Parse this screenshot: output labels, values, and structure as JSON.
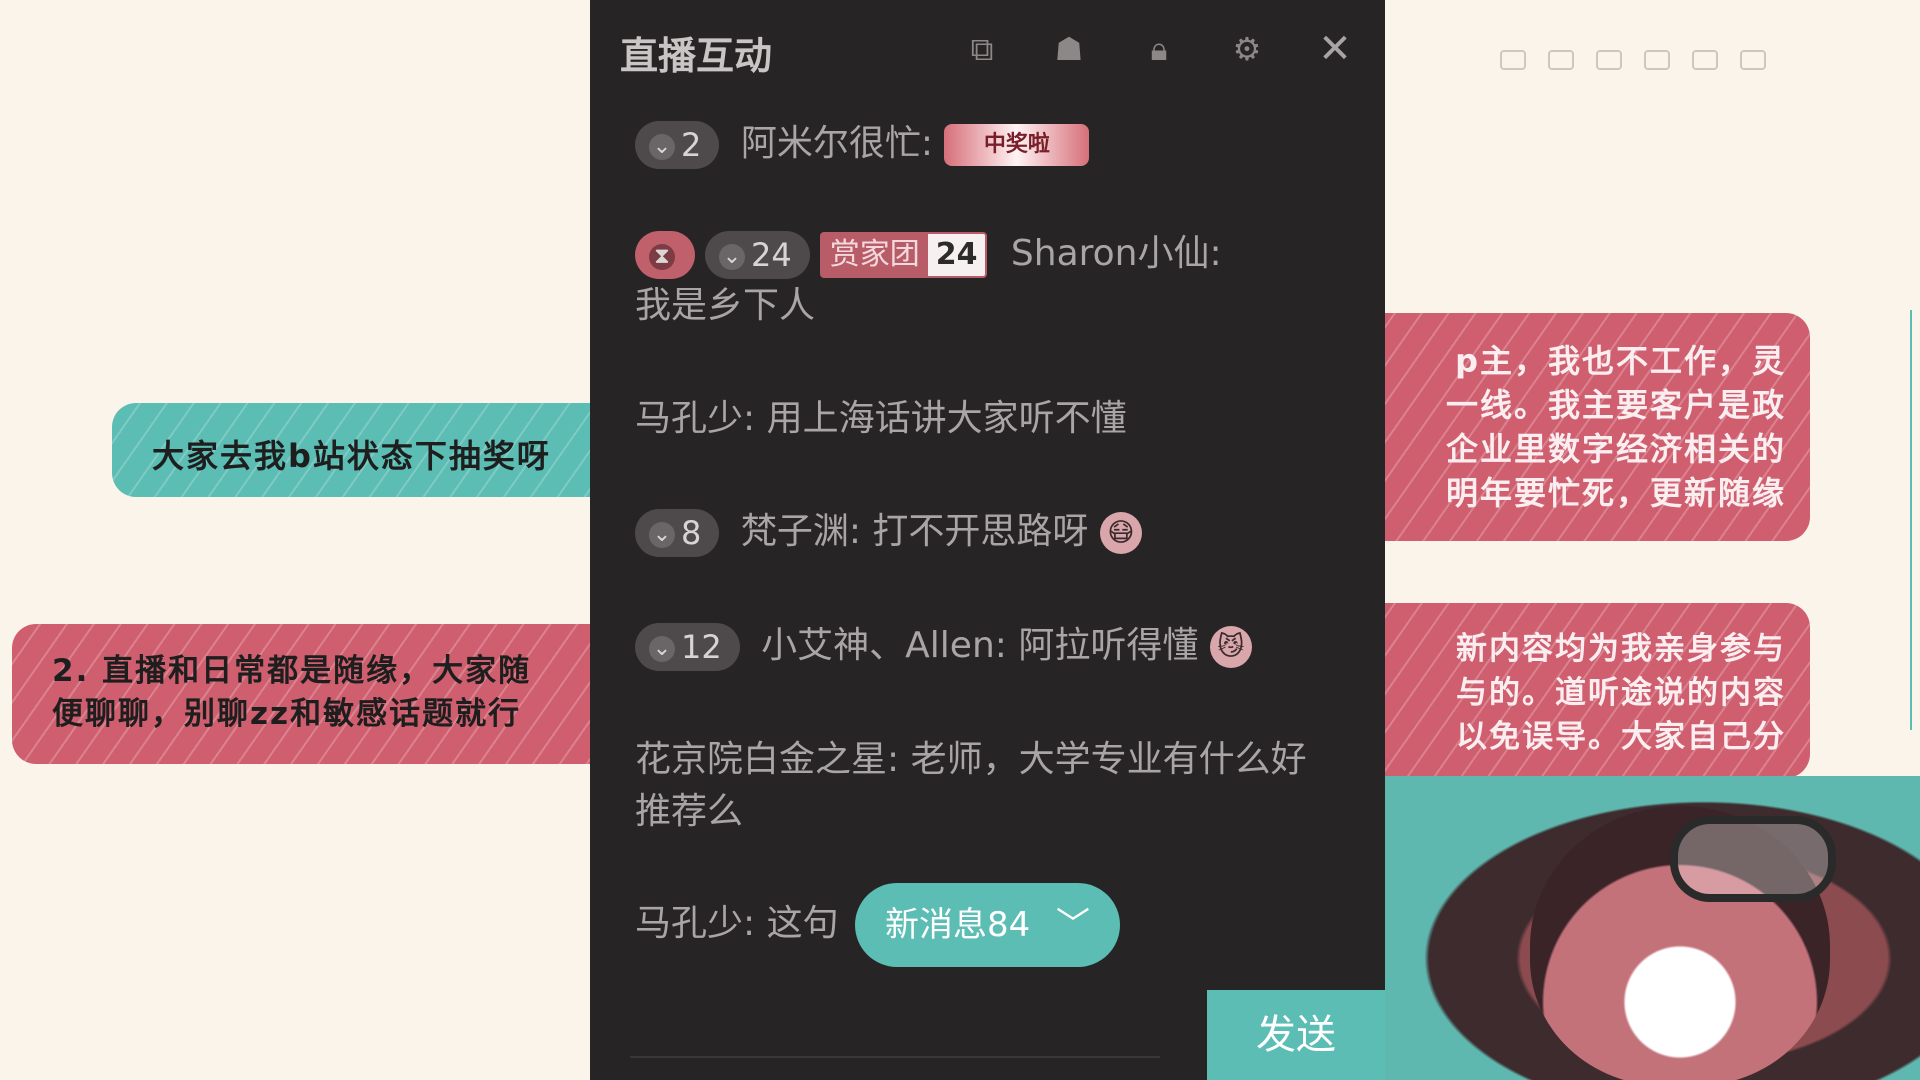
{
  "chat": {
    "title": "直播互动",
    "header_icons": [
      "popout-icon",
      "skin-icon",
      "lock-icon",
      "settings-icon",
      "close-icon"
    ],
    "close_glyph": "✕",
    "messages": [
      {
        "level": "2",
        "name": "阿米尔很忙:",
        "sticker": "中奖啦"
      },
      {
        "medal_icon": "hourglass-medal",
        "level": "24",
        "fan_club": "赏家团",
        "fan_level": "24",
        "name": "Sharon小仙:",
        "text": "我是乡下人"
      },
      {
        "name": "马孔少:",
        "text": "用上海话讲大家听不懂"
      },
      {
        "level": "8",
        "name": "梵子渊:",
        "text": "打不开思路呀"
      },
      {
        "level": "12",
        "name": "小艾神、Allen:",
        "text": "阿拉听得懂"
      },
      {
        "name": "花京院白金之星:",
        "text": "老师，大学专业有什么好推荐么"
      },
      {
        "name": "马孔少:",
        "text": "这句"
      }
    ],
    "new_messages_label": "新消息84",
    "send_label": "发送"
  },
  "notes": {
    "left_1": "大家去我b站状态下抽奖呀",
    "left_2_line_1": "2. 直播和日常都是随缘，大家随",
    "left_2_line_2": "便聊聊，别聊zz和敏感话题就行",
    "right_1_line_1": "p主，我也不工作，灵",
    "right_1_line_2": "一线。我主要客户是政",
    "right_1_line_3": "企业里数字经济相关的",
    "right_1_line_4": "明年要忙死，更新随缘",
    "right_2_line_1": "新内容均为我亲身参与",
    "right_2_line_2": "与的。道听途说的内容",
    "right_2_line_3": "以免误导。大家自己分"
  },
  "colors": {
    "teal": "#5bbdb3",
    "rose": "#cf5f6f",
    "panel": "#262425",
    "background": "#fbf4ea"
  }
}
